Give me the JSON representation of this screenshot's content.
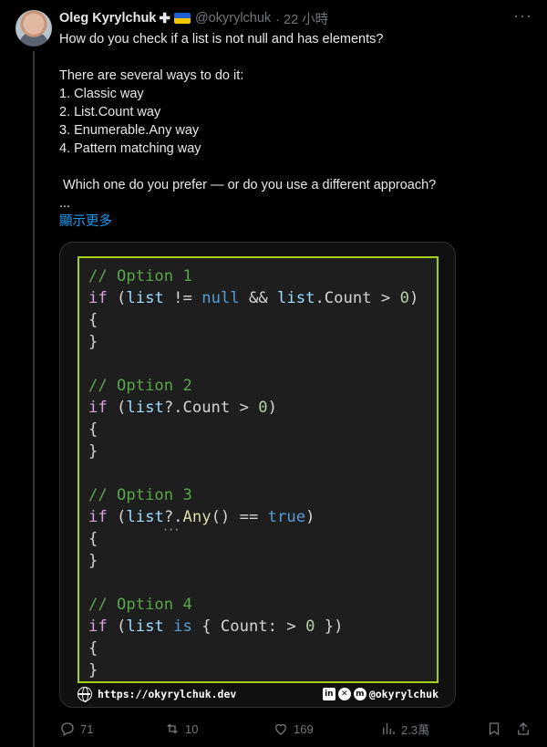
{
  "tweet": {
    "author_name": "Oleg Kyrylchuk",
    "author_badge": "✚",
    "handle": "@okyrylchuk",
    "time": "· 22 小時",
    "text_lines": [
      "How do you check if a list is not null and has elements?",
      "",
      "There are several ways to do it:",
      "1. Classic way",
      "2. List.Count way",
      "3. Enumerable.Any way",
      "4. Pattern matching way",
      "",
      " Which one do you prefer — or do you use a different approach?",
      "..."
    ],
    "show_more": "顯示更多"
  },
  "code_image": {
    "lines": [
      [
        {
          "t": "// Option 1",
          "c": "c-com"
        }
      ],
      [
        {
          "t": "if",
          "c": "c-kw"
        },
        {
          "t": " (",
          "c": ""
        },
        {
          "t": "list",
          "c": "c-var"
        },
        {
          "t": " != ",
          "c": ""
        },
        {
          "t": "null",
          "c": "c-blue"
        },
        {
          "t": " && ",
          "c": ""
        },
        {
          "t": "list",
          "c": "c-var"
        },
        {
          "t": ".Count > ",
          "c": ""
        },
        {
          "t": "0",
          "c": "c-num"
        },
        {
          "t": ")",
          "c": ""
        }
      ],
      [
        {
          "t": "{",
          "c": ""
        }
      ],
      [
        {
          "t": "}",
          "c": ""
        }
      ],
      [
        {
          "t": "",
          "c": ""
        }
      ],
      [
        {
          "t": "// Option 2",
          "c": "c-com"
        }
      ],
      [
        {
          "t": "if",
          "c": "c-kw"
        },
        {
          "t": " (",
          "c": ""
        },
        {
          "t": "list",
          "c": "c-var"
        },
        {
          "t": "?.Count > ",
          "c": ""
        },
        {
          "t": "0",
          "c": "c-num"
        },
        {
          "t": ")",
          "c": ""
        }
      ],
      [
        {
          "t": "{",
          "c": ""
        }
      ],
      [
        {
          "t": "}",
          "c": ""
        }
      ],
      [
        {
          "t": "",
          "c": ""
        }
      ],
      [
        {
          "t": "// Option 3",
          "c": "c-com"
        }
      ],
      [
        {
          "t": "if",
          "c": "c-kw"
        },
        {
          "t": " (",
          "c": ""
        },
        {
          "t": "list",
          "c": "c-var"
        },
        {
          "t": "?.",
          "c": "dots"
        },
        {
          "t": "Any",
          "c": "c-meth"
        },
        {
          "t": "() == ",
          "c": ""
        },
        {
          "t": "true",
          "c": "c-blue"
        },
        {
          "t": ")",
          "c": ""
        }
      ],
      [
        {
          "t": "{",
          "c": ""
        }
      ],
      [
        {
          "t": "}",
          "c": ""
        }
      ],
      [
        {
          "t": "",
          "c": ""
        }
      ],
      [
        {
          "t": "// Option 4",
          "c": "c-com"
        }
      ],
      [
        {
          "t": "if",
          "c": "c-kw"
        },
        {
          "t": " (",
          "c": ""
        },
        {
          "t": "list",
          "c": "c-var"
        },
        {
          "t": " ",
          "c": ""
        },
        {
          "t": "is",
          "c": "c-blue"
        },
        {
          "t": " { Count: > ",
          "c": ""
        },
        {
          "t": "0",
          "c": "c-num"
        },
        {
          "t": " })",
          "c": ""
        }
      ],
      [
        {
          "t": "{",
          "c": ""
        }
      ],
      [
        {
          "t": "}",
          "c": ""
        }
      ]
    ],
    "website": "https://okyrylchuk.dev",
    "social_handle": "@okyrylchuk",
    "social_icons": [
      "linkedin-icon",
      "bluesky-icon",
      "mastodon-icon"
    ]
  },
  "actions": {
    "replies": "71",
    "reposts": "10",
    "likes": "169",
    "views": "2.3萬"
  },
  "colors": {
    "background": "#000000",
    "text": "#e7e9ea",
    "muted": "#71767b",
    "link": "#1d9bf0",
    "code_border": "#a3d11b",
    "code_bg": "#1e1e1e"
  }
}
